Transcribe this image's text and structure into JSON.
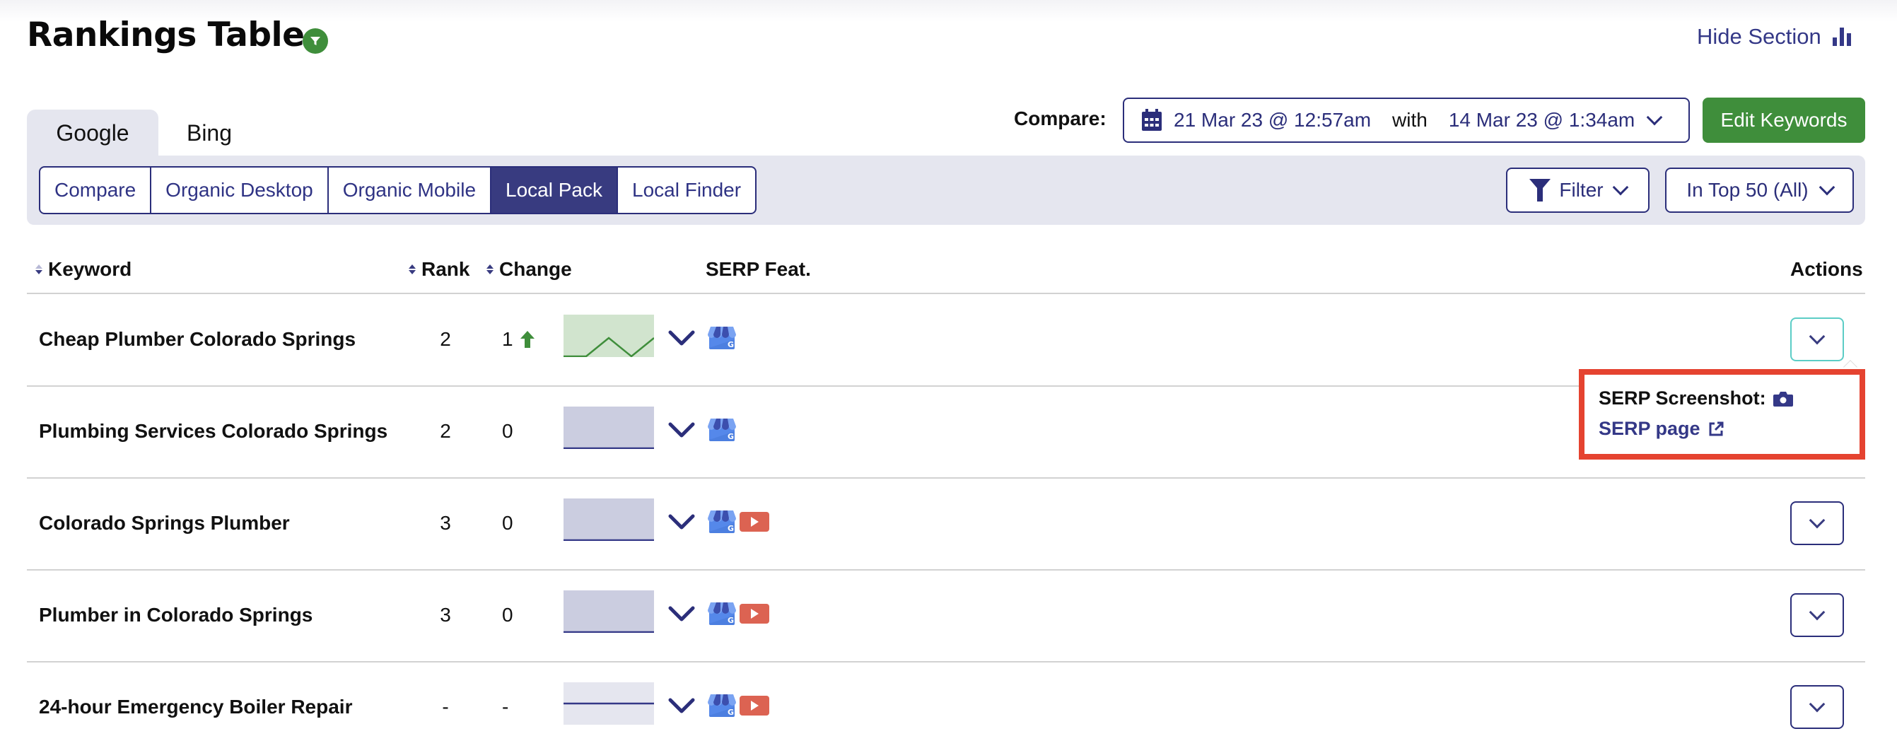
{
  "header": {
    "title": "Rankings Table",
    "hide_section_label": "Hide Section"
  },
  "engine_tabs": [
    {
      "label": "Google",
      "active": true
    },
    {
      "label": "Bing",
      "active": false
    }
  ],
  "view_tabs": [
    {
      "label": "Compare",
      "active": false
    },
    {
      "label": "Organic Desktop",
      "active": false
    },
    {
      "label": "Organic Mobile",
      "active": false
    },
    {
      "label": "Local Pack",
      "active": true
    },
    {
      "label": "Local Finder",
      "active": false
    }
  ],
  "compare": {
    "label": "Compare:",
    "from_date": "21 Mar 23 @ 12:57am",
    "with_label": "with",
    "to_date": "14 Mar 23 @ 1:34am"
  },
  "toolbar": {
    "edit_keywords_label": "Edit Keywords",
    "filter_label": "Filter",
    "top_filter_label": "In Top 50 (All)"
  },
  "table": {
    "columns": {
      "keyword": "Keyword",
      "rank": "Rank",
      "change": "Change",
      "serp_features": "SERP Feat.",
      "actions": "Actions"
    },
    "rows": [
      {
        "keyword": "Cheap Plumber Colorado Springs",
        "rank": "2",
        "change": "1",
        "change_direction": "up",
        "trend": [
          0,
          0,
          1,
          0,
          1
        ],
        "trend_status": "improved",
        "serp_features": [
          "google-my-business"
        ],
        "actions_open": true
      },
      {
        "keyword": "Plumbing Services Colorado Springs",
        "rank": "2",
        "change": "0",
        "change_direction": "none",
        "trend": [
          0,
          0,
          0,
          0,
          0
        ],
        "trend_status": "flat",
        "serp_features": [
          "google-my-business"
        ],
        "actions_open": false
      },
      {
        "keyword": "Colorado Springs Plumber",
        "rank": "3",
        "change": "0",
        "change_direction": "none",
        "trend": [
          0,
          0,
          0,
          0,
          0
        ],
        "trend_status": "flat",
        "serp_features": [
          "google-my-business",
          "video"
        ],
        "actions_open": false
      },
      {
        "keyword": "Plumber in Colorado Springs",
        "rank": "3",
        "change": "0",
        "change_direction": "none",
        "trend": [
          0,
          0,
          0,
          0,
          0
        ],
        "trend_status": "flat",
        "serp_features": [
          "google-my-business",
          "video"
        ],
        "actions_open": false
      },
      {
        "keyword": "24-hour Emergency Boiler Repair",
        "rank": "-",
        "change": "-",
        "change_direction": "none",
        "trend": [],
        "trend_status": "no-data",
        "serp_features": [
          "google-my-business",
          "video"
        ],
        "actions_open": false
      }
    ]
  },
  "actions_popover": {
    "screenshot_label": "SERP Screenshot:",
    "serp_page_label": "SERP page"
  },
  "colors": {
    "brand_navy": "#2b2e7a",
    "accent_green": "#3f8e3b",
    "highlight_red": "#e54330",
    "panel_gray": "#e5e6ef"
  }
}
